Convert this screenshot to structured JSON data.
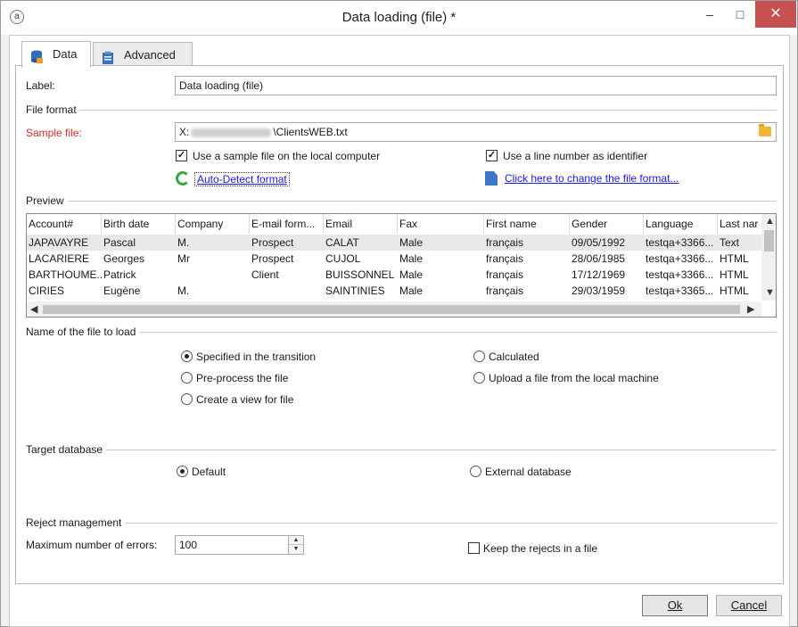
{
  "window": {
    "title": "Data loading (file) *",
    "minimize": "–",
    "maximize": "□",
    "close": "✕"
  },
  "tabs": [
    {
      "label": "Data",
      "icon": "database-icon"
    },
    {
      "label": "Advanced",
      "icon": "clipboard-icon"
    }
  ],
  "form": {
    "label_caption": "Label:",
    "label_value": "Data loading (file)",
    "file_format_heading": "File format",
    "sample_file_caption": "Sample file:",
    "sample_file_prefix": "X:",
    "sample_file_suffix": "\\ClientsWEB.txt",
    "use_sample_local": "Use a sample file on the local computer",
    "use_line_number": "Use a line number as identifier",
    "auto_detect": "Auto-Detect format",
    "change_format": "Click here to change the file format..."
  },
  "preview": {
    "heading": "Preview",
    "columns": [
      "Account#",
      "Birth date",
      "Company",
      "E-mail form...",
      "Email",
      "Fax",
      "First name",
      "Gender",
      "Language",
      "Last nar"
    ],
    "rows": [
      [
        "JAPAVAYRE",
        "Pascal",
        "M.",
        "Prospect",
        "CALAT",
        "Male",
        "français",
        "09/05/1992",
        "testqa+3366...",
        "Text"
      ],
      [
        "LACARIERE",
        "Georges",
        "Mr",
        "Prospect",
        "CUJOL",
        "Male",
        "français",
        "28/06/1985",
        "testqa+3366...",
        "HTML"
      ],
      [
        "BARTHOUME...",
        "Patrick",
        "",
        "Client",
        "BUISSONNEL",
        "Male",
        "français",
        "17/12/1969",
        "testqa+3366...",
        "HTML"
      ],
      [
        "CIRIES",
        "Eugène",
        "M.",
        "",
        "SAINTINIES",
        "Male",
        "français",
        "29/03/1959",
        "testqa+3365...",
        "HTML"
      ]
    ]
  },
  "file_to_load": {
    "heading": "Name of the file to load",
    "options": [
      "Specified in the transition",
      "Calculated",
      "Pre-process the file",
      "Upload a file from the local machine",
      "Create a view for file"
    ],
    "selected": "Specified in the transition"
  },
  "target_db": {
    "heading": "Target database",
    "options": [
      "Default",
      "External database"
    ],
    "selected": "Default"
  },
  "reject": {
    "heading": "Reject management",
    "max_errors_caption": "Maximum number of errors:",
    "max_errors_value": "100",
    "keep_rejects": "Keep the rejects in a file"
  },
  "buttons": {
    "ok": "Ok",
    "cancel": "Cancel"
  }
}
